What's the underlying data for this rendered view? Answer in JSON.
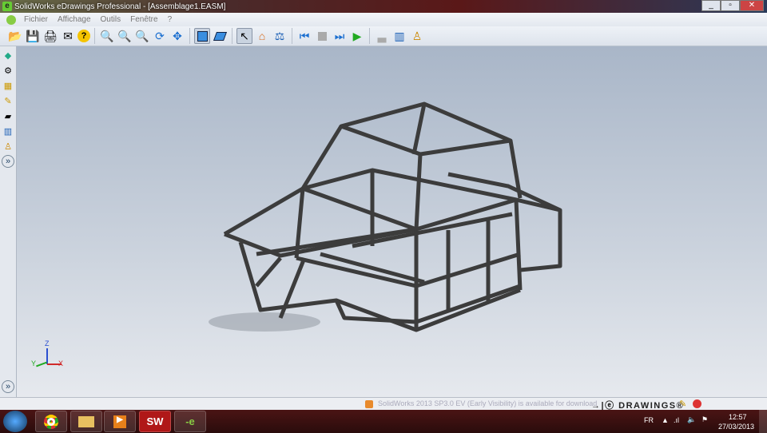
{
  "window": {
    "title": "SolidWorks eDrawings Professional - [Assemblage1.EASM]",
    "minimize": "_",
    "maximize": "▫",
    "close": "✕"
  },
  "menu": {
    "items": [
      "Fichier",
      "Affichage",
      "Outils",
      "Fenêtre",
      "?"
    ]
  },
  "toolbar": {
    "icons": [
      "open-icon",
      "save-icon",
      "print-icon",
      "email-icon",
      "help-icon",
      "zoom-fit-icon",
      "zoom-area-icon",
      "zoom-in-out-icon",
      "rotate-icon",
      "pan-icon",
      "shaded-icon",
      "perspective-icon",
      "select-icon",
      "home-icon",
      "measure-icon",
      "first-frame-icon",
      "stop-icon",
      "next-frame-icon",
      "play-icon",
      "explode-icon",
      "components-icon",
      "stamp-icon"
    ]
  },
  "status": {
    "message": "SolidWorks 2013 SP3.0 EV (Early Visibility) is available for download",
    "brand": "DRAWINGS®"
  },
  "triad": {
    "x": "X",
    "y": "Y",
    "z": "Z"
  },
  "taskbar": {
    "lang": "FR",
    "time": "12:57",
    "date": "27/03/2013",
    "sw": "SW",
    "ed": "-e"
  }
}
